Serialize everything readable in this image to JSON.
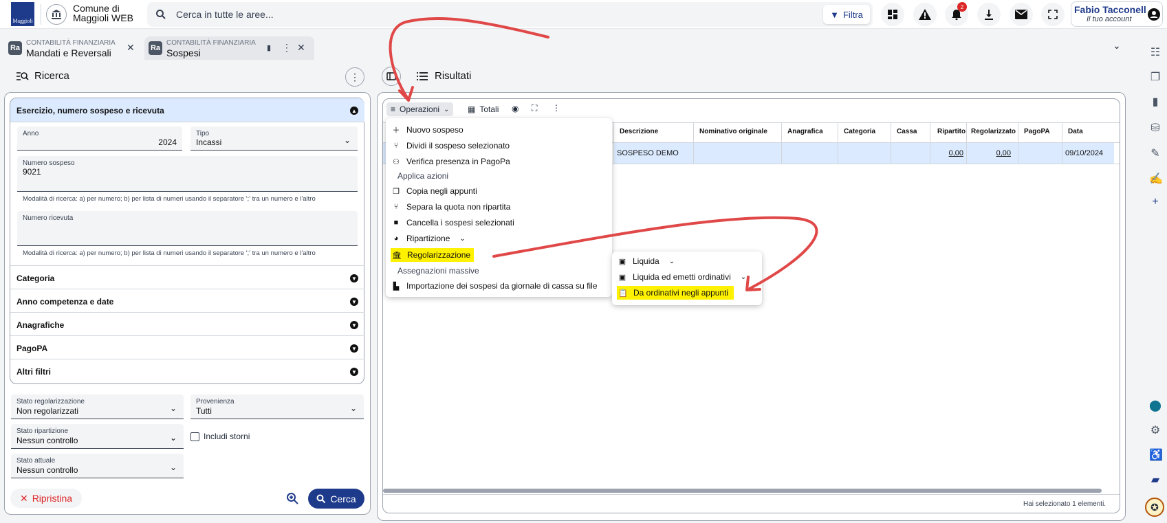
{
  "header": {
    "brand_line1": "Comune di",
    "brand_line2": "Maggioli WEB",
    "search_placeholder": "Cerca in tutte le aree...",
    "filter_label": "Filtra",
    "notif_count": "2",
    "account_name": "Fabio Tacconelli",
    "account_sub": "Il tuo account",
    "logo_text": "Maggioli"
  },
  "tabs": [
    {
      "module": "CONTABILITÀ FINANZIARIA",
      "title": "Mandati e Reversali"
    },
    {
      "module": "CONTABILITÀ FINANZIARIA",
      "title": "Sospesi"
    }
  ],
  "search_panel": {
    "title": "Ricerca",
    "section1": "Esercizio, numero sospeso e ricevuta",
    "anno_label": "Anno",
    "anno_value": "2024",
    "tipo_label": "Tipo",
    "tipo_value": "Incassi",
    "numsosp_label": "Numero sospeso",
    "numsosp_value": "9021",
    "hint": "Modalità di ricerca: a) per numero; b) per lista di numeri usando il separatore ';' tra un numero e l'altro",
    "numric_label": "Numero ricevuta",
    "sections": [
      "Categoria",
      "Anno competenza e date",
      "Anagrafiche",
      "PagoPA",
      "Altri filtri"
    ],
    "stato_reg_label": "Stato regolarizzazione",
    "stato_reg_value": "Non regolarizzati",
    "prov_label": "Provenienza",
    "prov_value": "Tutti",
    "stato_rip_label": "Stato ripartizione",
    "stato_rip_value": "Nessun controllo",
    "storni_label": "Includi storni",
    "stato_att_label": "Stato attuale",
    "stato_att_value": "Nessun controllo",
    "reset_label": "Ripristina",
    "search_label": "Cerca"
  },
  "results": {
    "title": "Risultati",
    "ops_label": "Operazioni",
    "totals_label": "Totali",
    "columns": [
      "Descrizione",
      "Nominativo originale",
      "Anagrafica",
      "Categoria",
      "Cassa",
      "Ripartito",
      "Regolarizzato",
      "PagoPA",
      "Data"
    ],
    "row": {
      "descrizione": "SOSPESO DEMO",
      "ripartito": "0,00",
      "regolarizzato": "0,00",
      "data": "09/10/2024"
    },
    "footer": "Hai selezionato 1 elementi."
  },
  "ops_menu": [
    "Nuovo sospeso",
    "Dividi il sospeso selezionato",
    "Verifica presenza in PagoPa",
    "Applica azioni",
    "Copia negli appunti",
    "Separa la quota non ripartita",
    "Cancella i sospesi selezionati",
    "Ripartizione",
    "Regolarizzazione",
    "Assegnazioni massive",
    "Importazione dei sospesi da giornale di cassa su file"
  ],
  "sub_menu": [
    "Liquida",
    "Liquida ed emetti ordinativi",
    "Da ordinativi negli appunti"
  ],
  "colors": {
    "primary": "#1e3a8a",
    "highlight": "#fff200",
    "arrow": "#e04848",
    "danger": "#dc2626"
  }
}
